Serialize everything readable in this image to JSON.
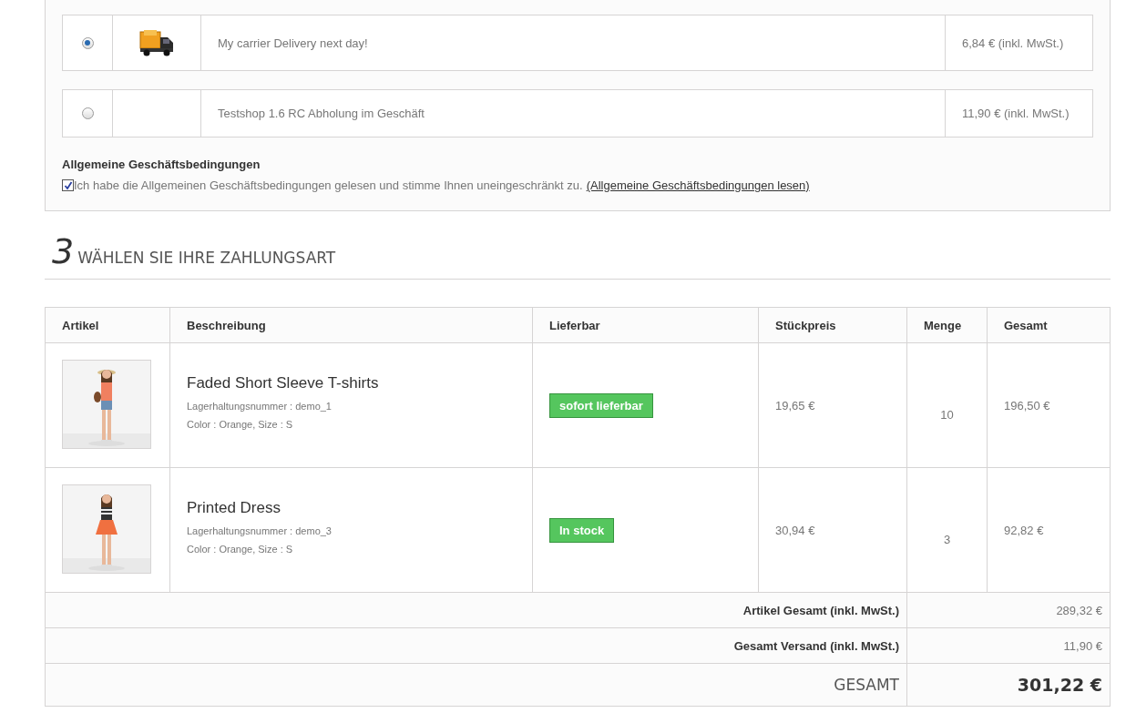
{
  "carriers": [
    {
      "selected": true,
      "has_icon": true,
      "name": "My carrier Delivery next day!",
      "price": "6,84 € (inkl. MwSt.)"
    },
    {
      "selected": false,
      "has_icon": false,
      "name": "Testshop 1.6 RC Abholung im Geschäft",
      "price": "11,90 € (inkl. MwSt.)"
    }
  ],
  "terms": {
    "title": "Allgemeine Geschäftsbedingungen",
    "checked": true,
    "text": "Ich habe die Allgemeinen Geschäftsbedingungen gelesen und stimme Ihnen uneingeschränkt zu.",
    "link": "(Allgemeine Geschäftsbedingungen lesen)"
  },
  "step": {
    "number": "3",
    "title": "WÄHLEN SIE IHRE ZAHLUNGSART"
  },
  "cart": {
    "columns": [
      "Artikel",
      "Beschreibung",
      "Lieferbar",
      "Stückpreis",
      "Menge",
      "Gesamt"
    ],
    "rows": [
      {
        "name": "Faded Short Sleeve T-shirts",
        "reference": "Lagerhaltungsnummer : demo_1",
        "attributes": "Color : Orange, Size : S",
        "availability": "sofort lieferbar",
        "unit_price": "19,65 €",
        "quantity": "10",
        "total": "196,50 €"
      },
      {
        "name": "Printed Dress",
        "reference": "Lagerhaltungsnummer : demo_3",
        "attributes": "Color : Orange, Size : S",
        "availability": "In stock",
        "unit_price": "30,94 €",
        "quantity": "3",
        "total": "92,82 €"
      }
    ],
    "summary": [
      {
        "kind": "subtotal",
        "label": "Artikel Gesamt (inkl. MwSt.)",
        "value": "289,32 €"
      },
      {
        "kind": "subtotal",
        "label": "Gesamt Versand (inkl. MwSt.)",
        "value": "11,90 €"
      },
      {
        "kind": "grand_total",
        "label": "GESAMT",
        "value": "301,22 €"
      }
    ]
  }
}
